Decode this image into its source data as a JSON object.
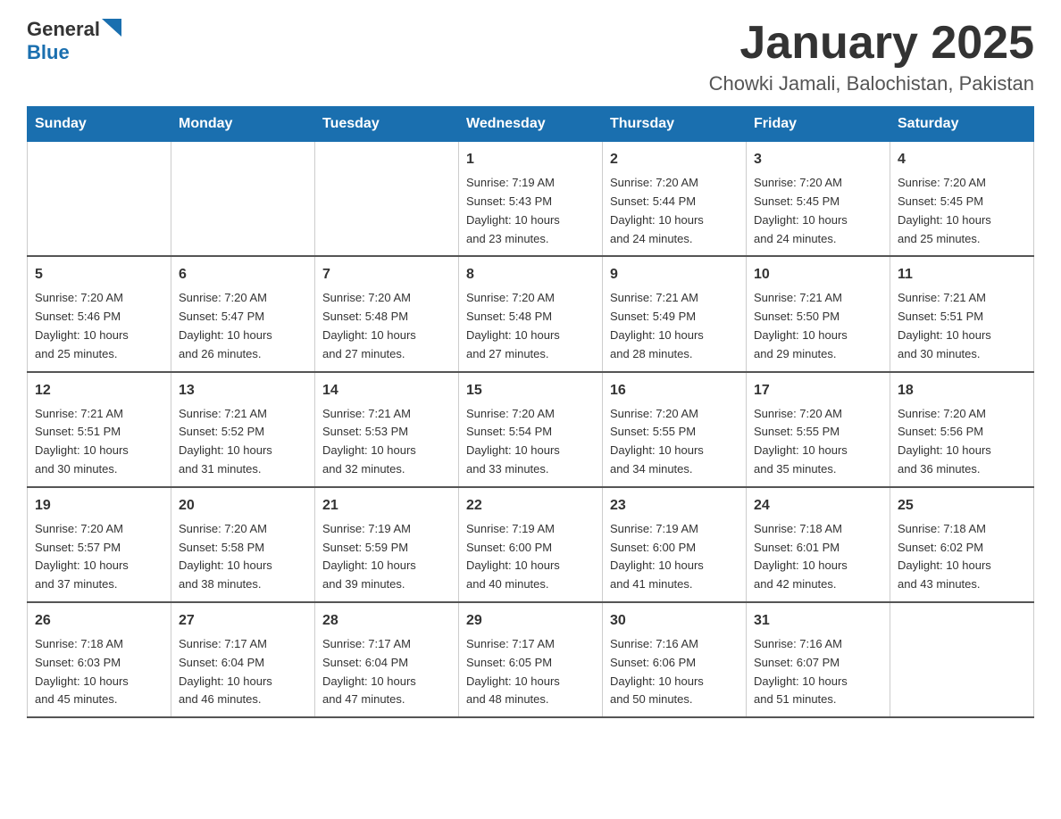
{
  "header": {
    "logo_general": "General",
    "logo_blue": "Blue",
    "month_title": "January 2025",
    "location": "Chowki Jamali, Balochistan, Pakistan"
  },
  "weekdays": [
    "Sunday",
    "Monday",
    "Tuesday",
    "Wednesday",
    "Thursday",
    "Friday",
    "Saturday"
  ],
  "weeks": [
    [
      {
        "day": "",
        "info": ""
      },
      {
        "day": "",
        "info": ""
      },
      {
        "day": "",
        "info": ""
      },
      {
        "day": "1",
        "info": "Sunrise: 7:19 AM\nSunset: 5:43 PM\nDaylight: 10 hours\nand 23 minutes."
      },
      {
        "day": "2",
        "info": "Sunrise: 7:20 AM\nSunset: 5:44 PM\nDaylight: 10 hours\nand 24 minutes."
      },
      {
        "day": "3",
        "info": "Sunrise: 7:20 AM\nSunset: 5:45 PM\nDaylight: 10 hours\nand 24 minutes."
      },
      {
        "day": "4",
        "info": "Sunrise: 7:20 AM\nSunset: 5:45 PM\nDaylight: 10 hours\nand 25 minutes."
      }
    ],
    [
      {
        "day": "5",
        "info": "Sunrise: 7:20 AM\nSunset: 5:46 PM\nDaylight: 10 hours\nand 25 minutes."
      },
      {
        "day": "6",
        "info": "Sunrise: 7:20 AM\nSunset: 5:47 PM\nDaylight: 10 hours\nand 26 minutes."
      },
      {
        "day": "7",
        "info": "Sunrise: 7:20 AM\nSunset: 5:48 PM\nDaylight: 10 hours\nand 27 minutes."
      },
      {
        "day": "8",
        "info": "Sunrise: 7:20 AM\nSunset: 5:48 PM\nDaylight: 10 hours\nand 27 minutes."
      },
      {
        "day": "9",
        "info": "Sunrise: 7:21 AM\nSunset: 5:49 PM\nDaylight: 10 hours\nand 28 minutes."
      },
      {
        "day": "10",
        "info": "Sunrise: 7:21 AM\nSunset: 5:50 PM\nDaylight: 10 hours\nand 29 minutes."
      },
      {
        "day": "11",
        "info": "Sunrise: 7:21 AM\nSunset: 5:51 PM\nDaylight: 10 hours\nand 30 minutes."
      }
    ],
    [
      {
        "day": "12",
        "info": "Sunrise: 7:21 AM\nSunset: 5:51 PM\nDaylight: 10 hours\nand 30 minutes."
      },
      {
        "day": "13",
        "info": "Sunrise: 7:21 AM\nSunset: 5:52 PM\nDaylight: 10 hours\nand 31 minutes."
      },
      {
        "day": "14",
        "info": "Sunrise: 7:21 AM\nSunset: 5:53 PM\nDaylight: 10 hours\nand 32 minutes."
      },
      {
        "day": "15",
        "info": "Sunrise: 7:20 AM\nSunset: 5:54 PM\nDaylight: 10 hours\nand 33 minutes."
      },
      {
        "day": "16",
        "info": "Sunrise: 7:20 AM\nSunset: 5:55 PM\nDaylight: 10 hours\nand 34 minutes."
      },
      {
        "day": "17",
        "info": "Sunrise: 7:20 AM\nSunset: 5:55 PM\nDaylight: 10 hours\nand 35 minutes."
      },
      {
        "day": "18",
        "info": "Sunrise: 7:20 AM\nSunset: 5:56 PM\nDaylight: 10 hours\nand 36 minutes."
      }
    ],
    [
      {
        "day": "19",
        "info": "Sunrise: 7:20 AM\nSunset: 5:57 PM\nDaylight: 10 hours\nand 37 minutes."
      },
      {
        "day": "20",
        "info": "Sunrise: 7:20 AM\nSunset: 5:58 PM\nDaylight: 10 hours\nand 38 minutes."
      },
      {
        "day": "21",
        "info": "Sunrise: 7:19 AM\nSunset: 5:59 PM\nDaylight: 10 hours\nand 39 minutes."
      },
      {
        "day": "22",
        "info": "Sunrise: 7:19 AM\nSunset: 6:00 PM\nDaylight: 10 hours\nand 40 minutes."
      },
      {
        "day": "23",
        "info": "Sunrise: 7:19 AM\nSunset: 6:00 PM\nDaylight: 10 hours\nand 41 minutes."
      },
      {
        "day": "24",
        "info": "Sunrise: 7:18 AM\nSunset: 6:01 PM\nDaylight: 10 hours\nand 42 minutes."
      },
      {
        "day": "25",
        "info": "Sunrise: 7:18 AM\nSunset: 6:02 PM\nDaylight: 10 hours\nand 43 minutes."
      }
    ],
    [
      {
        "day": "26",
        "info": "Sunrise: 7:18 AM\nSunset: 6:03 PM\nDaylight: 10 hours\nand 45 minutes."
      },
      {
        "day": "27",
        "info": "Sunrise: 7:17 AM\nSunset: 6:04 PM\nDaylight: 10 hours\nand 46 minutes."
      },
      {
        "day": "28",
        "info": "Sunrise: 7:17 AM\nSunset: 6:04 PM\nDaylight: 10 hours\nand 47 minutes."
      },
      {
        "day": "29",
        "info": "Sunrise: 7:17 AM\nSunset: 6:05 PM\nDaylight: 10 hours\nand 48 minutes."
      },
      {
        "day": "30",
        "info": "Sunrise: 7:16 AM\nSunset: 6:06 PM\nDaylight: 10 hours\nand 50 minutes."
      },
      {
        "day": "31",
        "info": "Sunrise: 7:16 AM\nSunset: 6:07 PM\nDaylight: 10 hours\nand 51 minutes."
      },
      {
        "day": "",
        "info": ""
      }
    ]
  ]
}
